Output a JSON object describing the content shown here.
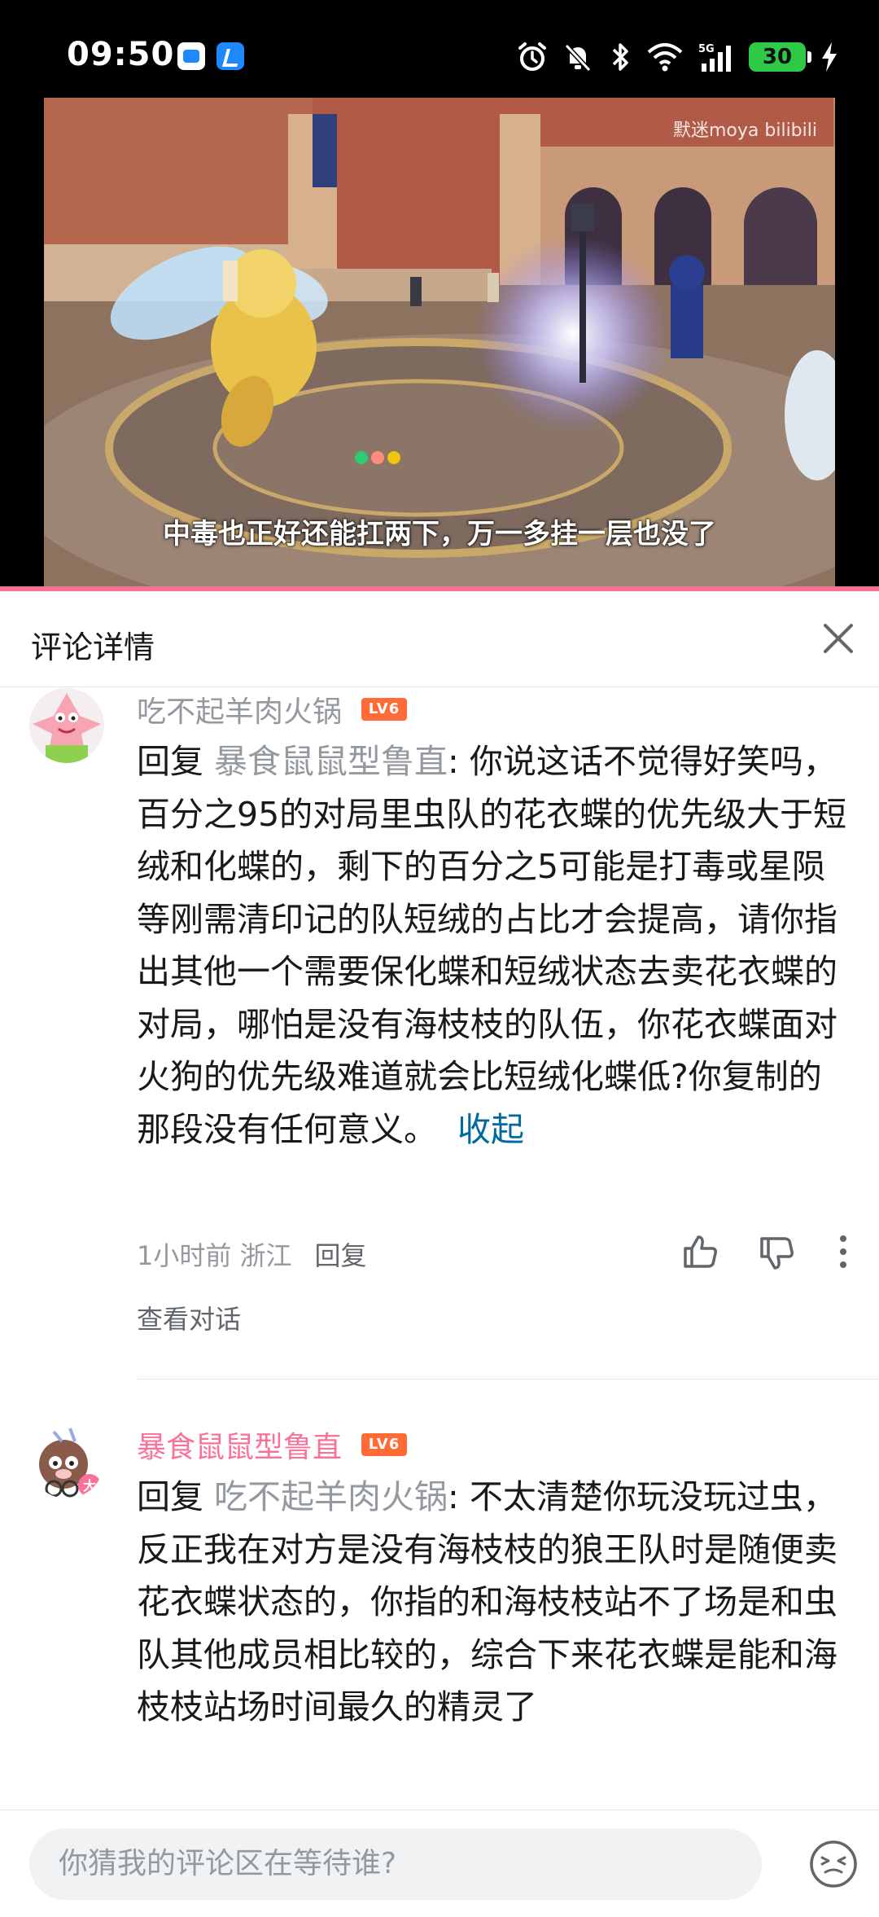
{
  "status_bar": {
    "time": "09:50",
    "battery": "30",
    "network": "5G"
  },
  "video": {
    "watermark": "默迷moya bilibili",
    "subtitle": "中毒也正好还能扛两下，万一多挂一层也没了"
  },
  "header": {
    "title": "评论详情"
  },
  "comments": [
    {
      "username": "吃不起羊肉火锅",
      "level": "LV6",
      "reply_prefix": "回复",
      "mention": "暴食鼠鼠型鲁直",
      "text": ": 你说这话不觉得好笑吗，百分之95的对局里虫队的花衣蝶的优先级大于短绒和化蝶的，剩下的百分之5可能是打毒或星陨等刚需清印记的队短绒的占比才会提高，请你指出其他一个需要保化蝶和短绒状态去卖花衣蝶的对局，哪怕是没有海枝枝的队伍，你花衣蝶面对火狗的优先级难道就会比短绒化蝶低?你复制的那段没有任何意义。",
      "collapse": "收起",
      "time_location": "1小时前 浙江",
      "reply_label": "回复",
      "view_conversation": "查看对话",
      "username_color": "#9499a0"
    },
    {
      "username": "暴食鼠鼠型鲁直",
      "level": "LV6",
      "reply_prefix": "回复",
      "mention": "吃不起羊肉火锅",
      "text": ": 不太清楚你玩没玩过虫，反正我在对方是没有海枝枝的狼王队时是随便卖花衣蝶状态的，你指的和海枝枝站不了场是和虫队其他成员相比较的，综合下来花衣蝶是能和海枝枝站场时间最久的精灵了",
      "username_color": "#fb7299"
    }
  ],
  "input": {
    "placeholder": "你猜我的评论区在等待谁?"
  },
  "icons": {
    "close": "close-icon",
    "like": "thumbs-up-icon",
    "dislike": "thumbs-down-icon",
    "more": "more-vertical-icon",
    "emoji": "emoji-icon"
  },
  "colors": {
    "accent_pink": "#fb7299",
    "link_blue": "#00699d",
    "level_orange": "#ff6a36",
    "muted_gray": "#9499a0"
  }
}
